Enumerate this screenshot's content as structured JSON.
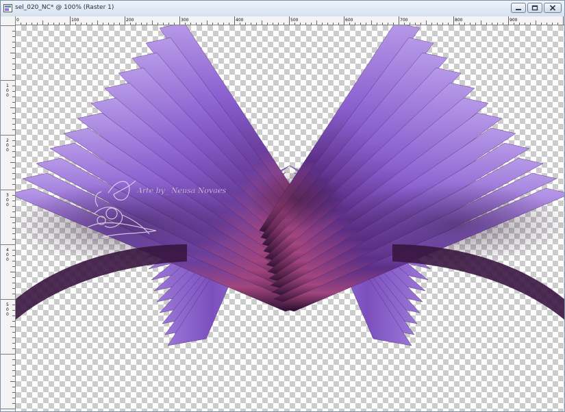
{
  "window": {
    "title": "sel_020_NC* @ 100% (Raster 1)",
    "buttons": [
      "minimize",
      "restore",
      "close"
    ]
  },
  "rulers": {
    "horizontal_labels": [
      "0",
      "100",
      "200",
      "300",
      "400",
      "500",
      "600",
      "700",
      "800",
      "900"
    ],
    "vertical_labels": [
      "1\n0\n0",
      "2\n0\n0",
      "3\n0\n0",
      "4\n0\n0",
      "5\n0\n0"
    ]
  },
  "canvas": {
    "background": "transparent-checkerboard",
    "zoom_percent": 100
  },
  "artwork": {
    "watermark_text": "Arte by_ Neusa Novaes",
    "colors": {
      "light_purple": "#9a76d6",
      "mid_purple": "#7b4fbd",
      "dark_plum": "#2a0f2e",
      "magenta": "#a1457e"
    }
  },
  "icons": {
    "app": "app-document-icon",
    "minimize": "minimize-icon",
    "restore": "restore-icon",
    "close": "close-icon"
  }
}
